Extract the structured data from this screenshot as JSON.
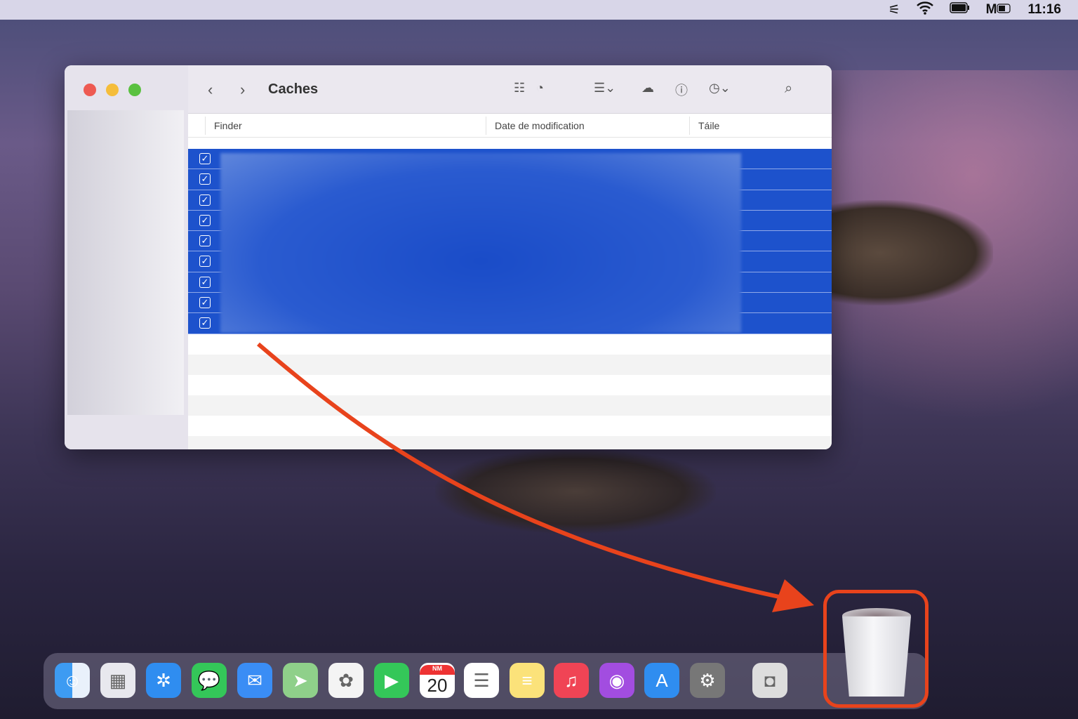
{
  "menubar": {
    "icons": [
      "control-center-icon",
      "wifi-icon",
      "battery-icon",
      "keyboard-input-icon"
    ],
    "input_label": "M",
    "clock": "11:16"
  },
  "window": {
    "title": "Caches",
    "columns": [
      "Finder",
      "Date de modification",
      "Táile"
    ],
    "selected_rows": 9,
    "checkmark": "✓"
  },
  "dock": {
    "calendar_month": "NM",
    "calendar_day": "20",
    "apps": [
      "finder",
      "launchpad",
      "safari",
      "messages",
      "mail",
      "maps",
      "photos",
      "facetime",
      "calendar",
      "reminders",
      "notes",
      "music",
      "podcasts",
      "app-store",
      "system-preferences",
      "screenshot",
      "trash"
    ]
  },
  "colors": {
    "selection": "#1d52cc",
    "annotation": "#e8431c"
  }
}
